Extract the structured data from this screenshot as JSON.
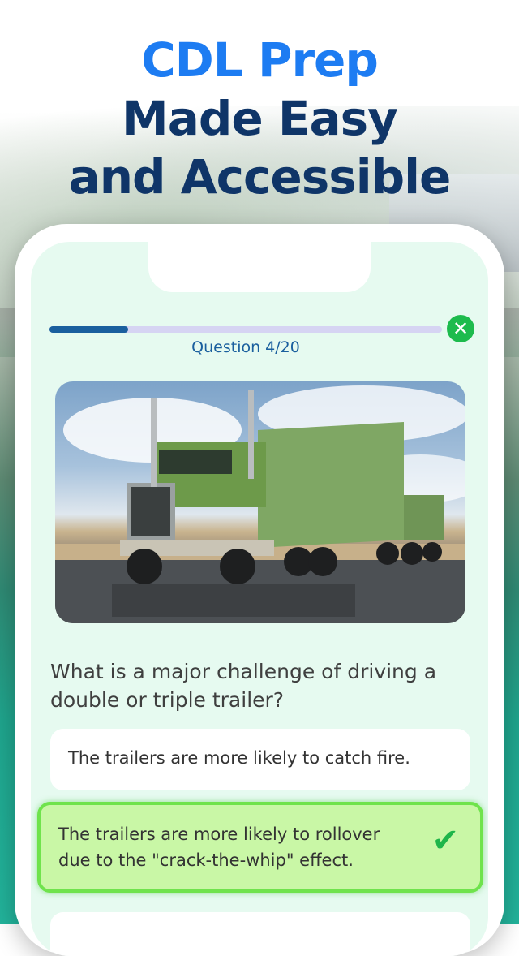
{
  "headline": {
    "line1": "CDL Prep",
    "line2": "Made Easy",
    "line3": "and Accessible"
  },
  "quiz": {
    "progress": 0.2,
    "counter": "Question 4/20",
    "close_icon": "close-circle-icon",
    "question": "What is a major challenge of driving a double or triple trailer?",
    "options": [
      {
        "text": "The trailers are more likely to catch fire.",
        "selected": false
      },
      {
        "text": "The trailers are more likely to rollover due to the \"crack-the-whip\" effect.",
        "selected": true,
        "icon": "check-icon"
      },
      {
        "text": "",
        "selected": false
      }
    ]
  },
  "colors": {
    "accent_blue": "#1d7cf2",
    "navy": "#0f3568",
    "correct_green": "#6fe34c",
    "close_green": "#1dbb4d"
  }
}
